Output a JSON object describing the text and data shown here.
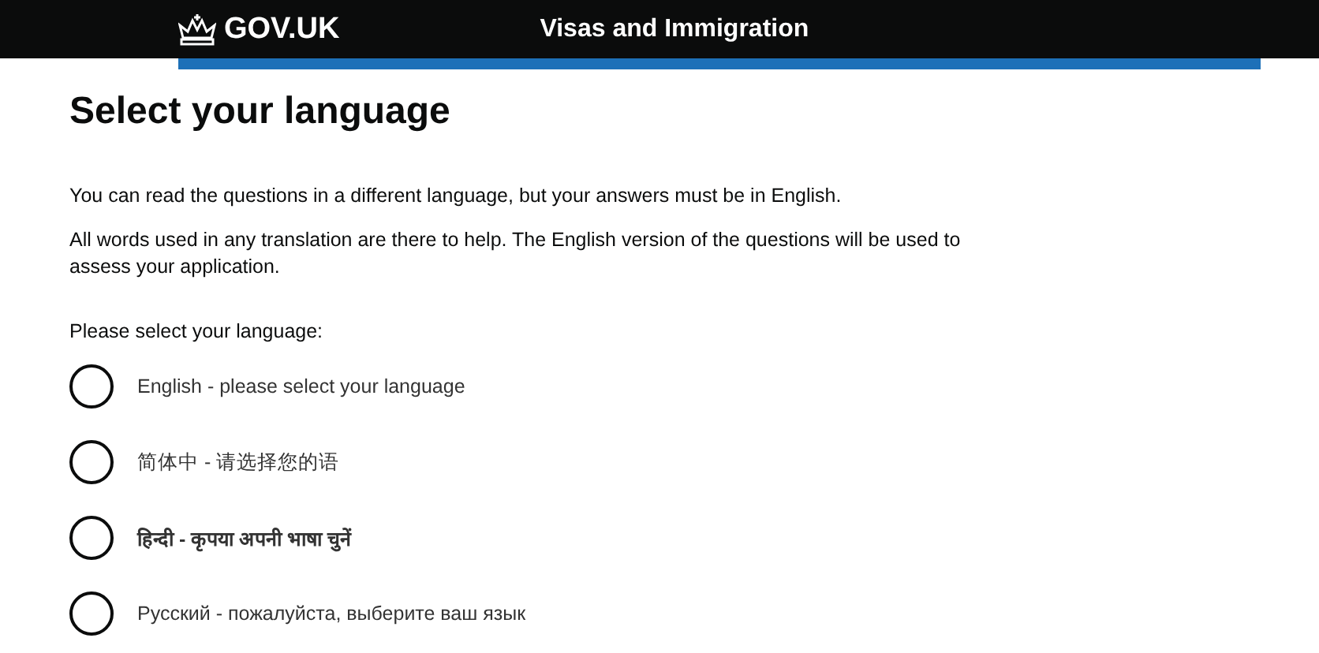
{
  "header": {
    "logo": "GOV.UK",
    "service": "Visas and Immigration"
  },
  "heading": "Select your language",
  "paragraphs": [
    "You can read the questions in a different language, but your answers must be in English.",
    "All words used in any translation are there to help. The English version of the questions will be used to assess your application."
  ],
  "question": "Please select your language:",
  "options": [
    {
      "label": "English - please select your language",
      "selected": false
    },
    {
      "label": "简体中 - 请选择您的语",
      "selected": false
    },
    {
      "label": "हिन्दी - कृपया अपनी भाषा चुनें",
      "selected": false
    },
    {
      "label": "Русский - пожалуйста, выберите ваш язык",
      "selected": false
    }
  ]
}
